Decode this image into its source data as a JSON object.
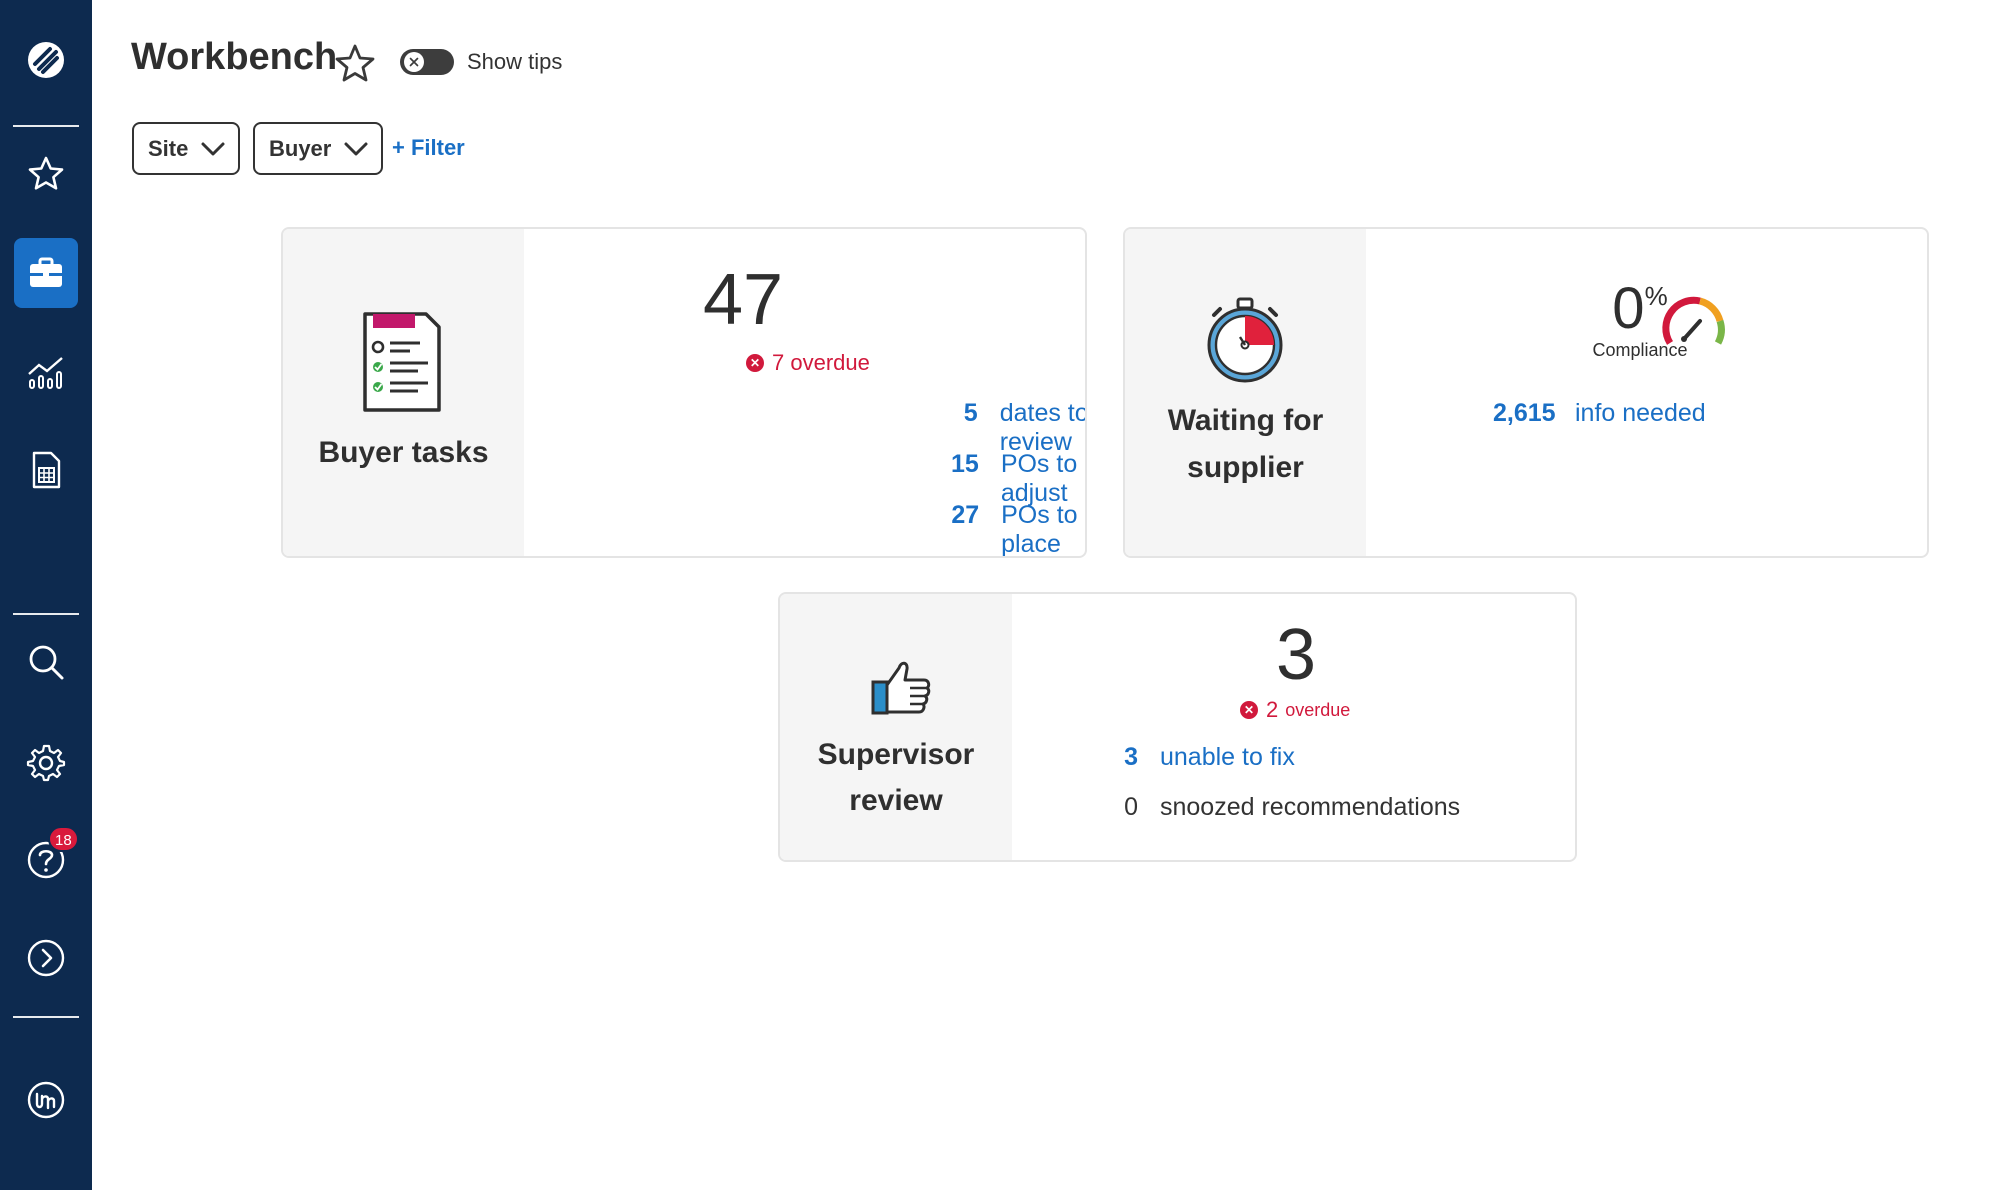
{
  "header": {
    "title": "Workbench",
    "tips_label": "Show tips",
    "tips_enabled": false
  },
  "filters": {
    "site_label": "Site",
    "buyer_label": "Buyer",
    "add_filter_label": "+ Filter"
  },
  "sidebar": {
    "items": [
      {
        "name": "favorites",
        "icon": "star-icon"
      },
      {
        "name": "workbench",
        "icon": "briefcase-icon",
        "active": true
      },
      {
        "name": "analytics",
        "icon": "chart-icon"
      },
      {
        "name": "reports",
        "icon": "document-icon"
      },
      {
        "name": "search",
        "icon": "search-icon"
      },
      {
        "name": "settings",
        "icon": "gear-icon"
      },
      {
        "name": "help",
        "icon": "help-icon"
      },
      {
        "name": "expand",
        "icon": "chevron-right-circle-icon"
      },
      {
        "name": "account",
        "icon": "user-logo-icon"
      }
    ],
    "help_badge": "18"
  },
  "cards": {
    "buyer_tasks": {
      "title": "Buyer tasks",
      "total": "47",
      "overdue": "7 overdue",
      "rows": [
        {
          "count": "5",
          "label": "dates to review"
        },
        {
          "count": "15",
          "label": "POs to adjust"
        },
        {
          "count": "27",
          "label": "POs to place"
        }
      ]
    },
    "waiting_supplier": {
      "title_line1": "Waiting for",
      "title_line2": "supplier",
      "compliance_value": "0",
      "compliance_unit": "%",
      "compliance_label": "Compliance",
      "info_count": "2,615",
      "info_label": "info needed"
    },
    "supervisor_review": {
      "title_line1": "Supervisor",
      "title_line2": "review",
      "total": "3",
      "overdue_count": "2",
      "overdue_label": "overdue",
      "rows": [
        {
          "count": "3",
          "label": "unable to fix"
        },
        {
          "count": "0",
          "label": "snoozed recommendations"
        }
      ]
    }
  },
  "colors": {
    "sidebar_bg": "#0d2a4f",
    "accent": "#1a6fc5",
    "danger": "#d1193c",
    "card_left_bg": "#f5f5f5"
  }
}
